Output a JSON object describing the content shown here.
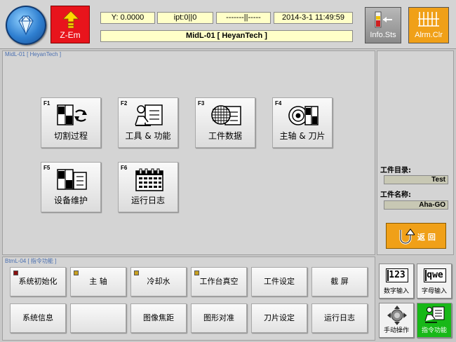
{
  "top": {
    "logo_icon": "diamond-logo-icon",
    "zem_label": "Z-Em",
    "status_y": "Y: 0.0000",
    "status_ipt": "ipt:0||0",
    "status_line": "-------||-----",
    "status_time": "2014-3-1 11:49:59",
    "title": "MidL-01 [ HeyanTech ]",
    "info_label": "Info.Sts",
    "alarm_label": "Alrm.Clr"
  },
  "main": {
    "panel_label": "MidL-01 [ HeyanTech ]",
    "buttons": [
      {
        "key": "F1",
        "label": "切割过程",
        "icon": "cut-process-icon"
      },
      {
        "key": "F2",
        "label": "工具 & 功能",
        "icon": "tools-icon"
      },
      {
        "key": "F3",
        "label": "工件数据",
        "icon": "wafer-data-icon"
      },
      {
        "key": "F4",
        "label": "主轴 & 刀片",
        "icon": "spindle-blade-icon"
      },
      {
        "key": "F5",
        "label": "设备维护",
        "icon": "maintenance-icon"
      },
      {
        "key": "F6",
        "label": "运行日志",
        "icon": "calendar-log-icon"
      }
    ]
  },
  "right": {
    "dir_label": "工件目录:",
    "dir_value": "Test",
    "name_label": "工件名称:",
    "name_value": "Aha-GO",
    "back_label": "返 回"
  },
  "bottom": {
    "panel_label": "BtmL-04 [ 指令功能 ]",
    "row1": [
      "系统初始化",
      "主 轴",
      "冷却水",
      "工作台真空",
      "工件设定",
      "截 屏"
    ],
    "row2": [
      "系统信息",
      "",
      "图像焦距",
      "图形对准",
      "刀片设定",
      "运行日志"
    ]
  },
  "bottom_right": {
    "num_key": "123",
    "num_label": "数字输入",
    "alpha_key": "qwe",
    "alpha_label": "字母输入",
    "manual_label": "手动操作",
    "cmd_label": "指令功能"
  },
  "colors": {
    "zem_red": "#e8141c",
    "alarm_orange": "#f0a018",
    "cmd_green": "#18b818",
    "status_yellow": "#ffffc8"
  }
}
